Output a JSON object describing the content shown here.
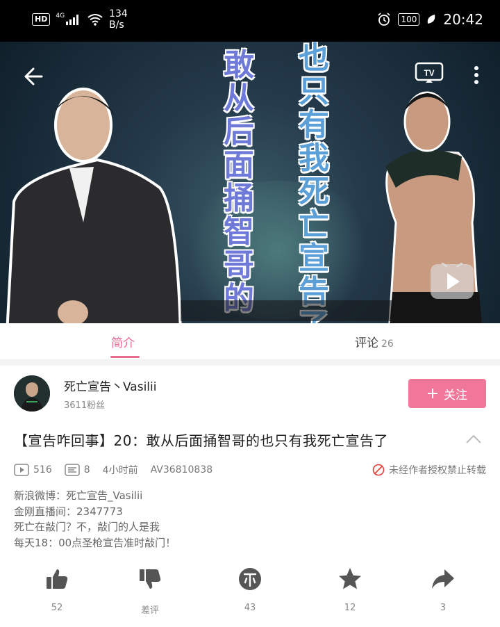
{
  "status_bar": {
    "hd": "HD",
    "net": "4G",
    "speed_value": "134",
    "speed_unit": "B/s",
    "battery": "100",
    "time": "20:42"
  },
  "video": {
    "caption_col1": [
      "敢",
      "从",
      "后",
      "面",
      "捅",
      "智",
      "哥",
      "的"
    ],
    "caption_col2": [
      "也",
      "只",
      "有",
      "我",
      "死",
      "亡",
      "宣",
      "告",
      "了"
    ],
    "tv_label": "TV"
  },
  "tabs": {
    "intro": "简介",
    "comments": "评论",
    "comments_count": "26"
  },
  "uploader": {
    "name": "死亡宣告丶Vasilii",
    "fans": "3611粉丝",
    "follow_label": "关注"
  },
  "title": "【宣告咋回事】20：敢从后面捅智哥的也只有我死亡宣告了",
  "meta": {
    "plays": "516",
    "danmaku": "8",
    "time_ago": "4小时前",
    "av_id": "AV36810838",
    "repost_notice": "未经作者授权禁止转载"
  },
  "description": [
    "新浪微博：死亡宣告_Vasilii",
    "金刚直播间：2347773",
    "死亡在敲门？不，敲门的人是我",
    "每天18：00点圣枪宣告准时敲门！"
  ],
  "actions": {
    "like": "52",
    "dislike": "差评",
    "coin": "43",
    "favorite": "12",
    "share": "3"
  },
  "colors": {
    "accent": "#e86a8f",
    "follow_bg": "#f1779a"
  }
}
